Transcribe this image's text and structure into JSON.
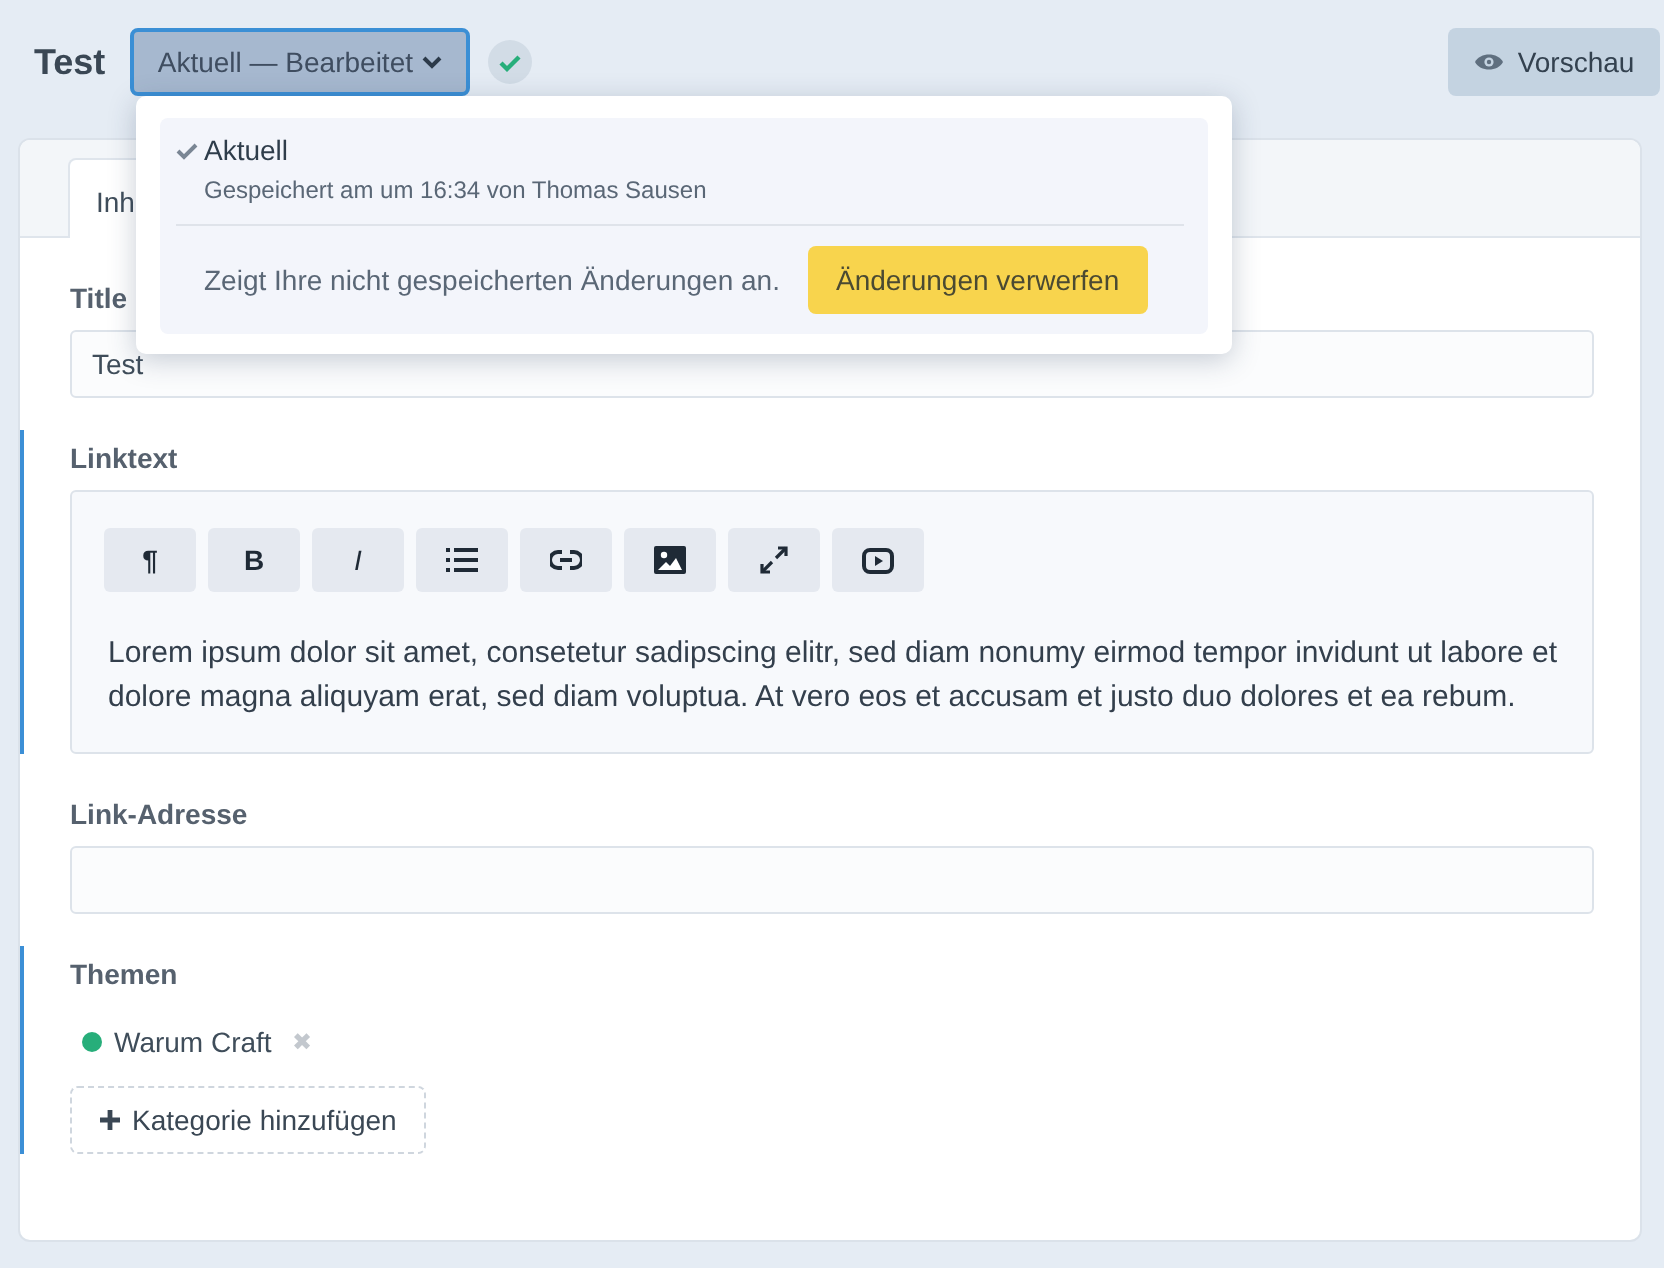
{
  "header": {
    "title": "Test",
    "revision_button": "Aktuell — Bearbeitet",
    "saved": true,
    "preview_button": "Vorschau"
  },
  "tabs": [
    {
      "label": "Inh",
      "selected": true
    }
  ],
  "revision_menu": {
    "items": [
      {
        "label": "Aktuell",
        "subtitle": "Gespeichert am um 16:34 von Thomas Sausen",
        "selected": true
      }
    ],
    "notice": "Zeigt Ihre nicht gespeicherten Änderungen an.",
    "discard_button": "Änderungen verwerfen"
  },
  "fields": [
    {
      "kind": "text",
      "label": "Title",
      "value": "Test",
      "modified": false
    },
    {
      "kind": "richtext",
      "label": "Linktext",
      "modified": true,
      "toolbar": [
        {
          "kind": "glyph",
          "label": "¶"
        },
        {
          "kind": "glyph",
          "label": "B"
        },
        {
          "kind": "glyph",
          "label": "I"
        },
        {
          "kind": "list"
        },
        {
          "kind": "link"
        },
        {
          "kind": "image"
        },
        {
          "kind": "expand"
        },
        {
          "kind": "video"
        }
      ],
      "body": "Lorem ipsum dolor sit amet, consetetur sadipscing elitr, sed diam nonumy eirmod tempor invidunt ut labore et dolore magna aliquyam erat, sed diam voluptua. At vero eos et accusam et justo duo dolores et ea rebum."
    },
    {
      "kind": "text",
      "label": "Link-Adresse",
      "modified": false
    },
    {
      "kind": "categories",
      "label": "Themen",
      "modified": true,
      "tags": [
        {
          "label": "Warum Craft",
          "color": "#27ae7a",
          "remove": "✖"
        }
      ],
      "add_button": "Kategorie hinzufügen"
    }
  ]
}
